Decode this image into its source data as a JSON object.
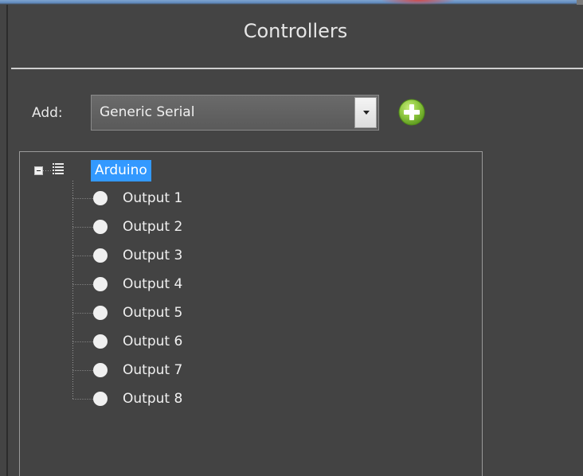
{
  "panel": {
    "title": "Controllers"
  },
  "add_row": {
    "label": "Add:",
    "selected_type": "Generic Serial",
    "add_button_icon": "plus-circle-icon"
  },
  "tree": {
    "root": {
      "label": "Arduino",
      "icon": "list-icon",
      "expanded": true,
      "selected": true
    },
    "children": [
      {
        "label": "Output 1",
        "icon": "output-dot-icon"
      },
      {
        "label": "Output 2",
        "icon": "output-dot-icon"
      },
      {
        "label": "Output 3",
        "icon": "output-dot-icon"
      },
      {
        "label": "Output 4",
        "icon": "output-dot-icon"
      },
      {
        "label": "Output 5",
        "icon": "output-dot-icon"
      },
      {
        "label": "Output 6",
        "icon": "output-dot-icon"
      },
      {
        "label": "Output 7",
        "icon": "output-dot-icon"
      },
      {
        "label": "Output 8",
        "icon": "output-dot-icon"
      }
    ]
  },
  "colors": {
    "background": "#444444",
    "selection": "#3399ff",
    "add_button": "#8dc63f"
  }
}
